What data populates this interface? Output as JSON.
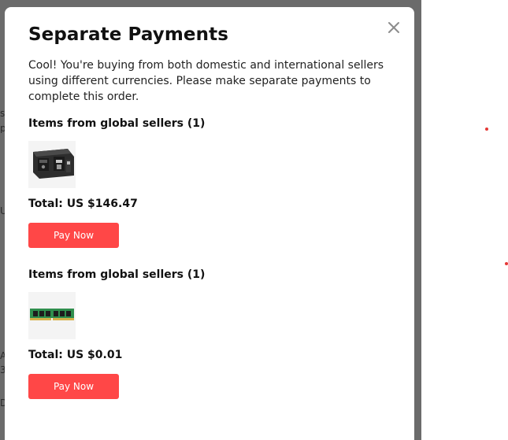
{
  "modal": {
    "title": "Separate Payments",
    "description": "Cool! You're buying from both domestic and international sellers using different currencies. Please make separate payments to complete this order.",
    "close_icon": "close-icon",
    "groups": [
      {
        "heading": "Items from global sellers (1)",
        "product_image": "usb-socket-panel-image",
        "total": "Total: US $146.47",
        "pay_label": "Pay Now"
      },
      {
        "heading": "Items from global sellers (1)",
        "product_image": "ram-memory-stick-image",
        "total": "Total: US $0.01",
        "pay_label": "Pay Now"
      }
    ]
  },
  "background": {
    "edge_glyphs": [
      "s",
      "p",
      "U",
      "A",
      "3",
      "D"
    ]
  },
  "colors": {
    "accent": "#ff4747",
    "overlay": "#6b6b6b",
    "text": "#111111"
  }
}
